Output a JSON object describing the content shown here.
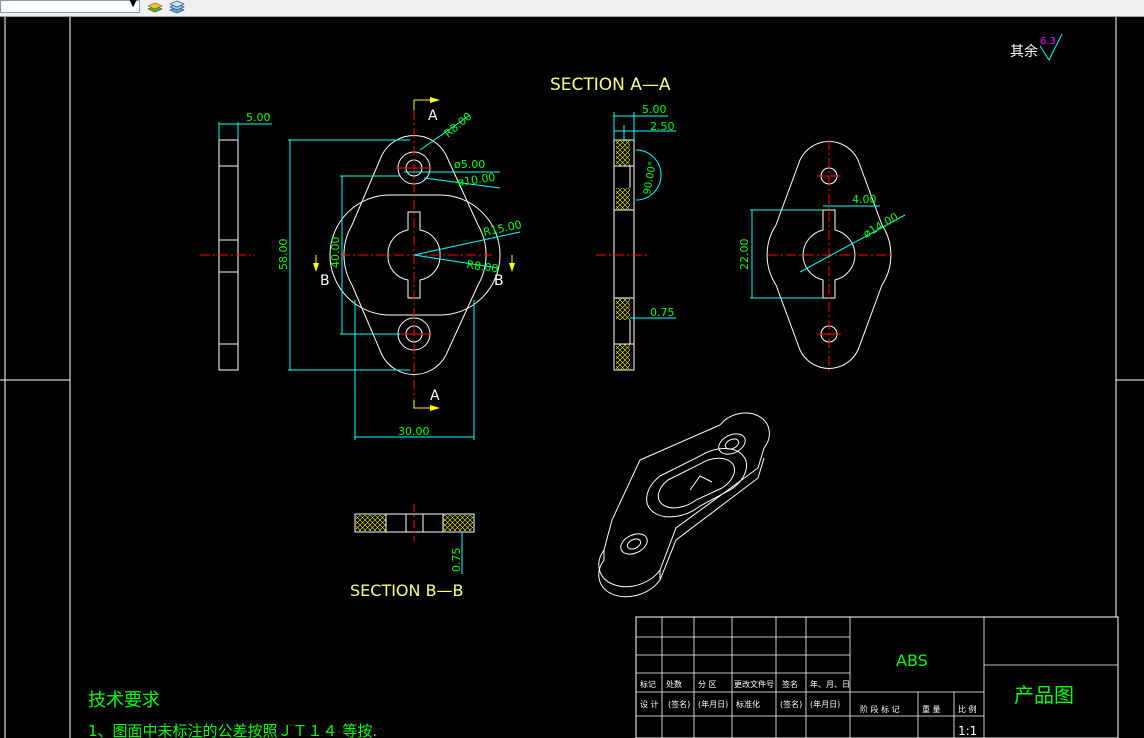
{
  "toolbar": {
    "layer_combo_value": "",
    "buttons": [
      "layer-properties-icon",
      "layer-states-icon"
    ]
  },
  "drawing": {
    "roughness_note_prefix": "其余",
    "roughness_value": "6.3",
    "section_aa_title": "SECTION A—A",
    "section_bb_title": "SECTION B—B",
    "cut_labels": {
      "a_top": "A",
      "a_bottom": "A",
      "b_left": "B",
      "b_right": "B"
    },
    "dims": {
      "side_width": "5.00",
      "height_total": "58.00",
      "hole_spacing": "40.00",
      "r_outer": "R8.00",
      "dia_hole": "ø5.00",
      "dia_counterbore": "ø10.00",
      "r_mid": "R15.00",
      "r_small": "R8.00",
      "width_total": "30.00",
      "sec_thickness": "5.00",
      "sec_half": "2.50",
      "sec_angle": "90.00°",
      "sec_step": "0.75",
      "rv_slot_width": "4.00",
      "rv_dia": "ø14.00",
      "rv_slot_height": "22.00",
      "bb_step": "0.75"
    },
    "notes": {
      "title": "技术要求",
      "line1": "1、图面中未标注的公差按照ＪＴ１４ 等按."
    },
    "title_block": {
      "material": "ABS",
      "drawing_name": "产品图",
      "row_revision": [
        "标记",
        "处数",
        "分 区",
        "更改文件号",
        "签名",
        "年、月、日"
      ],
      "row_signoff": [
        "设 计",
        "(签名)",
        "(年月日)",
        "标准化",
        "(签名)",
        "(年月日)"
      ],
      "stage_headers": [
        "阶 段 标 记",
        "重 量",
        "比 例"
      ],
      "scale": "1:1"
    }
  },
  "colors": {
    "outline": "#ffffff",
    "dimension": "#00ff00",
    "centerline": "#ff0000",
    "arrow": "#ffff00",
    "dim_line": "#00ffff",
    "hatch": "#ffff00",
    "frame": "#ffffff",
    "roughness": "#ff00ff"
  }
}
